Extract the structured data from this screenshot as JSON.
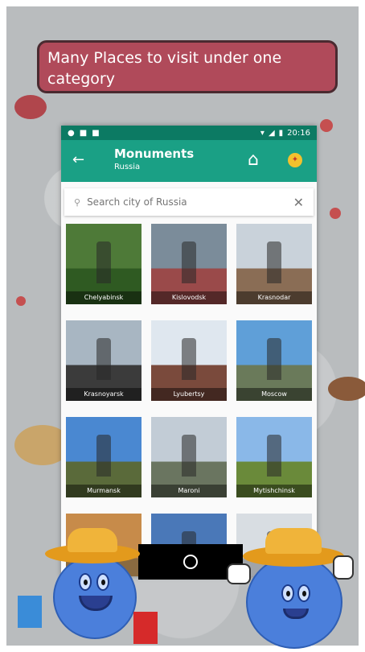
{
  "banner": {
    "text": "Many Places to visit under one category"
  },
  "status_bar": {
    "time": "20:16"
  },
  "app_bar": {
    "back_icon": "arrow-left-icon",
    "title": "Monuments",
    "subtitle": "Russia",
    "home_icon": "home-icon",
    "flag_icon": "badge-icon"
  },
  "search": {
    "placeholder": "Search city of Russia",
    "clear_icon": "close-icon"
  },
  "places": [
    {
      "label": "Chelyabinsk",
      "sky": "#4e7a38",
      "ground": "#2f5a22"
    },
    {
      "label": "Kislovodsk",
      "sky": "#7b8c9a",
      "ground": "#9a4a4a"
    },
    {
      "label": "Krasnodar",
      "sky": "#c9d2da",
      "ground": "#8a6d55"
    },
    {
      "label": "Krasnoyarsk",
      "sky": "#a8b6c2",
      "ground": "#3b3b3b"
    },
    {
      "label": "Lyubertsy",
      "sky": "#dfe7ef",
      "ground": "#7a4a3c"
    },
    {
      "label": "Moscow",
      "sky": "#5f9fd8",
      "ground": "#6a7a5a"
    },
    {
      "label": "Murmansk",
      "sky": "#4a88d1",
      "ground": "#5a6a3a"
    },
    {
      "label": "Maroni",
      "sky": "#c2ccd6",
      "ground": "#6a7560"
    },
    {
      "label": "Mytishchinsk",
      "sky": "#8ab8e8",
      "ground": "#6a8a3a"
    },
    {
      "label": "",
      "sky": "#c78b4a",
      "ground": "#8a6a40"
    },
    {
      "label": "",
      "sky": "#4a78b8",
      "ground": "#6a5040"
    },
    {
      "label": "",
      "sky": "#d8dde2",
      "ground": "#a0a4a8"
    }
  ],
  "nav_bar": {
    "home_button_icon": "circle-home-icon"
  }
}
